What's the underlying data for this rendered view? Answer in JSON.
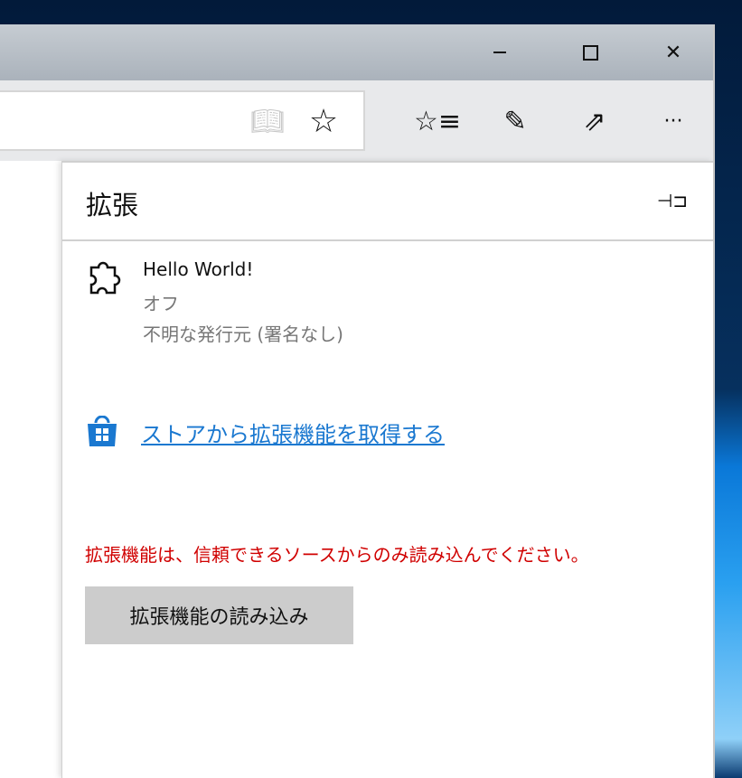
{
  "window": {
    "minimize_icon": "minimize-icon",
    "maximize_icon": "maximize-icon",
    "close_icon": "close-icon"
  },
  "toolbar": {
    "reading_view": "book-icon",
    "favorite": "star-icon",
    "hub": "favorites-list-icon",
    "notes": "pen-icon",
    "share": "share-icon",
    "more": "···"
  },
  "panel": {
    "title": "拡張",
    "pin": "pin-icon",
    "extension": {
      "name": "Hello World!",
      "status": "オフ",
      "publisher": "不明な発行元 (署名なし)"
    },
    "store_link": "ストアから拡張機能を取得する",
    "warning": "拡張機能は、信頼できるソースからのみ読み込んでください。",
    "load_button": "拡張機能の読み込み"
  },
  "colors": {
    "link": "#1a78d0",
    "warning": "#d00000",
    "button": "#cccccc"
  }
}
